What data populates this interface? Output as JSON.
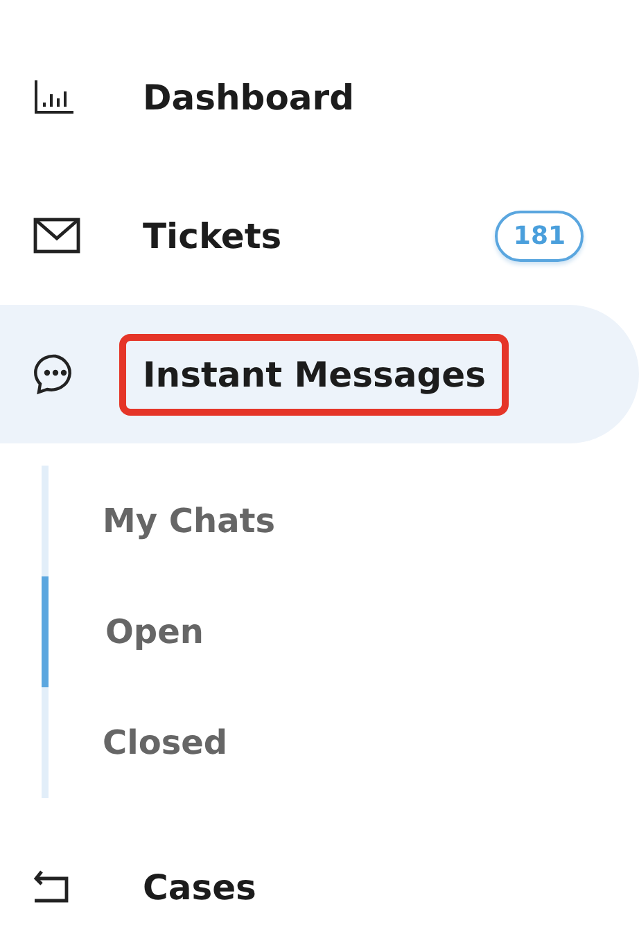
{
  "sidebar": {
    "items": [
      {
        "label": "Dashboard",
        "selected": false,
        "highlighted": false
      },
      {
        "label": "Tickets",
        "badge": "181",
        "selected": false,
        "highlighted": false
      },
      {
        "label": "Instant Messages",
        "selected": true,
        "highlighted": true,
        "children": [
          {
            "label": "My Chats",
            "selected": false
          },
          {
            "label": "Open",
            "selected": true
          },
          {
            "label": "Closed",
            "selected": false
          }
        ]
      },
      {
        "label": "Cases",
        "selected": false,
        "highlighted": false
      }
    ]
  }
}
